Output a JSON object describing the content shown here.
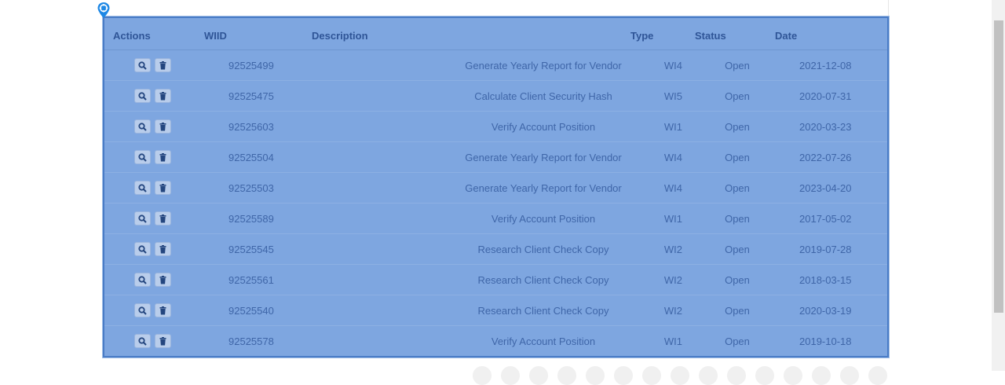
{
  "table": {
    "headers": {
      "actions": "Actions",
      "wiid": "WIID",
      "description": "Description",
      "type": "Type",
      "status": "Status",
      "date": "Date"
    },
    "rows": [
      {
        "wiid": "92525499",
        "description": "Generate Yearly Report for Vendor",
        "type": "WI4",
        "status": "Open",
        "date": "2021-12-08"
      },
      {
        "wiid": "92525475",
        "description": "Calculate Client Security Hash",
        "type": "WI5",
        "status": "Open",
        "date": "2020-07-31"
      },
      {
        "wiid": "92525603",
        "description": "Verify Account Position",
        "type": "WI1",
        "status": "Open",
        "date": "2020-03-23"
      },
      {
        "wiid": "92525504",
        "description": "Generate Yearly Report for Vendor",
        "type": "WI4",
        "status": "Open",
        "date": "2022-07-26"
      },
      {
        "wiid": "92525503",
        "description": "Generate Yearly Report for Vendor",
        "type": "WI4",
        "status": "Open",
        "date": "2023-04-20"
      },
      {
        "wiid": "92525589",
        "description": "Verify Account Position",
        "type": "WI1",
        "status": "Open",
        "date": "2017-05-02"
      },
      {
        "wiid": "92525545",
        "description": "Research Client Check Copy",
        "type": "WI2",
        "status": "Open",
        "date": "2019-07-28"
      },
      {
        "wiid": "92525561",
        "description": "Research Client Check Copy",
        "type": "WI2",
        "status": "Open",
        "date": "2018-03-15"
      },
      {
        "wiid": "92525540",
        "description": "Research Client Check Copy",
        "type": "WI2",
        "status": "Open",
        "date": "2020-03-19"
      },
      {
        "wiid": "92525578",
        "description": "Verify Account Position",
        "type": "WI1",
        "status": "Open",
        "date": "2019-10-18"
      }
    ],
    "row_actions": {
      "view_icon": "search-icon",
      "delete_icon": "trash-icon"
    }
  },
  "colors": {
    "table_bg": "#7ea6e0",
    "table_border": "#4a7cc6",
    "header_text": "#2f5597",
    "cell_text": "#3f66a8",
    "button_bg": "#b9cdeb",
    "pin_marker": "#1e88e5"
  },
  "marker_icon": "location-pin-icon"
}
